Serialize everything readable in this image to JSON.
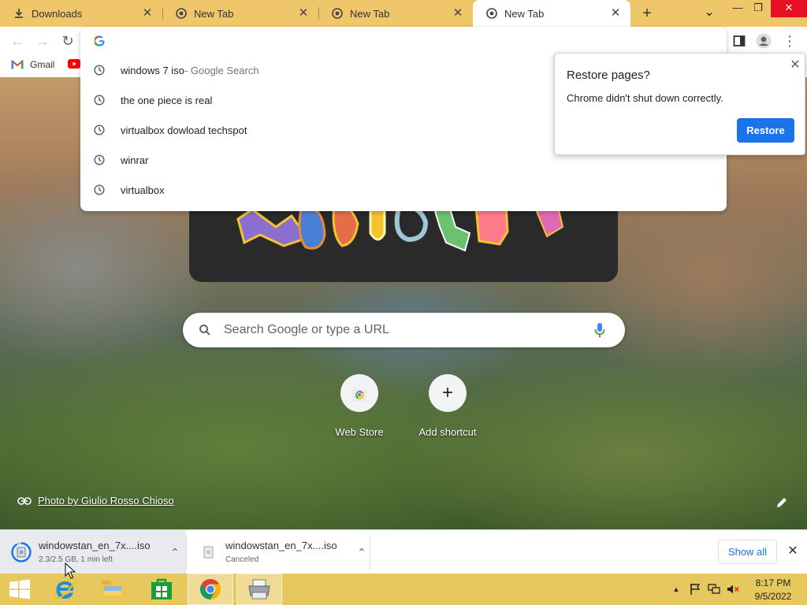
{
  "tabs": [
    {
      "label": "Downloads",
      "icon": "download-icon"
    },
    {
      "label": "New Tab",
      "icon": "chrome-icon"
    },
    {
      "label": "New Tab",
      "icon": "chrome-icon"
    },
    {
      "label": "New Tab",
      "icon": "chrome-icon",
      "active": true
    }
  ],
  "window_controls": {
    "minimize": "—",
    "restore": "❐",
    "close": "✕"
  },
  "tab_close_glyph": "✕",
  "new_tab_glyph": "+",
  "tab_search_glyph": "⌄",
  "toolbar": {
    "back_glyph": "←",
    "forward_glyph": "→",
    "reload_glyph": "↻",
    "menu_glyph": "⋮"
  },
  "bookmarks": [
    {
      "label": "Gmail",
      "icon": "gmail-icon"
    },
    {
      "label": "",
      "icon": "youtube-icon"
    }
  ],
  "omnibox": {
    "value": "",
    "suggestions": [
      {
        "text": "windows 7 iso",
        "suffix": " - Google Search"
      },
      {
        "text": "the one piece is real",
        "suffix": ""
      },
      {
        "text": "virtualbox dowload techspot",
        "suffix": ""
      },
      {
        "text": "winrar",
        "suffix": ""
      },
      {
        "text": "virtualbox",
        "suffix": ""
      }
    ]
  },
  "restore_bubble": {
    "title": "Restore pages?",
    "message": "Chrome didn't shut down correctly.",
    "button": "Restore",
    "close_glyph": "✕"
  },
  "ntp": {
    "search_placeholder": "Search Google or type a URL",
    "shortcuts": [
      {
        "label": "Web Store",
        "icon": "web-store-icon"
      },
      {
        "label": "Add shortcut",
        "icon": "plus-icon",
        "glyph": "+"
      }
    ],
    "photo_credit": "Photo by Giulio Rosso Chioso"
  },
  "downloads": [
    {
      "name": "windowstan_en_7x....iso",
      "status": "2.3/2.5 GB, 1 min left",
      "chevron": "⌃"
    },
    {
      "name": "windowstan_en_7x....iso",
      "status": "Canceled",
      "chevron": "⌃"
    }
  ],
  "shelf": {
    "show_all": "Show all",
    "close_glyph": "✕"
  },
  "taskbar": {
    "apps": [
      "windows-start-icon",
      "internet-explorer-icon",
      "file-explorer-icon",
      "store-icon",
      "chrome-icon",
      "printer-icon"
    ],
    "tray_up_glyph": "▲",
    "time": "8:17 PM",
    "date": "9/5/2022"
  },
  "colors": {
    "tab_strip": "#f0c66a",
    "accent_blue": "#1a73e8",
    "taskbar": "#e7c85f",
    "close_red": "#e81123"
  }
}
